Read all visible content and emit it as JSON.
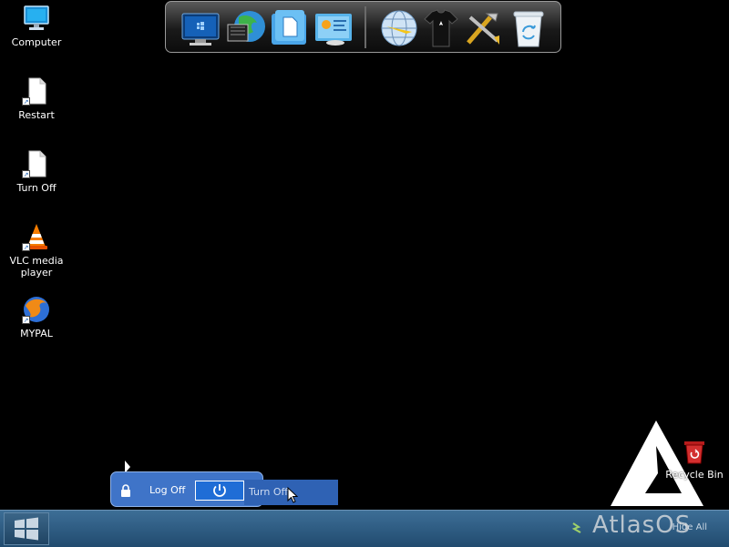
{
  "desktop": {
    "icons": [
      {
        "label": "Computer",
        "icon": "monitor-icon"
      },
      {
        "label": "Restart",
        "icon": "document-shortcut-icon"
      },
      {
        "label": "Turn Off",
        "icon": "document-shortcut-icon"
      },
      {
        "label": "VLC media player",
        "icon": "vlc-cone-icon"
      },
      {
        "label": "MYPAL",
        "icon": "mypal-browser-icon"
      }
    ],
    "recycle_bin": {
      "label": "Recycle Bin",
      "icon": "recycle-bin-icon"
    }
  },
  "dock": {
    "items": [
      "computer-icon",
      "web-globe-icon",
      "documents-icon",
      "control-panel-icon",
      "browser-globe-icon",
      "tshirt-icon",
      "tools-icon",
      "recycle-bin-icon"
    ]
  },
  "shutdown_menu": {
    "logoff_label": "Log Off",
    "tooltip": "Turn Off Computer"
  },
  "taskbar": {
    "start_icon": "windows-logo-icon",
    "tray_text": "Hide All"
  },
  "branding": {
    "wordmark": "AtlasOS"
  },
  "colors": {
    "desktop_bg": "#000000",
    "taskbar": "#2b5a80",
    "menu_bg": "#3f74c8",
    "power_button": "#1f6dd6"
  }
}
